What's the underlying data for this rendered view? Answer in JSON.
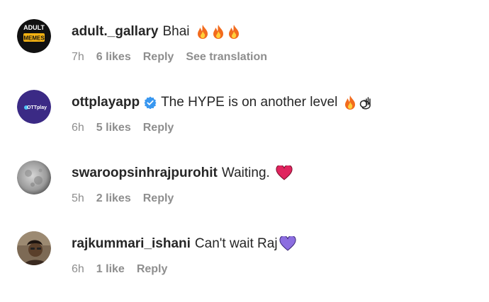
{
  "comments": [
    {
      "avatar": {
        "text_top": "ADULT",
        "text_bottom": "MEMES",
        "colors": {
          "bg": "#111111",
          "accent": "#f5b313"
        }
      },
      "username": "adult._gallary",
      "text": "Bhai",
      "emoji": [
        "fire-emoji",
        "fire-emoji",
        "fire-emoji"
      ],
      "time": "7h",
      "likes": "6 likes",
      "reply": "Reply",
      "translate": "See translation"
    },
    {
      "avatar": {
        "text": "OTTplay",
        "colors": {
          "bg": "#3b2a85"
        }
      },
      "username": "ottplayapp",
      "verified": true,
      "text": "The HYPE is on another level",
      "emoji": [
        "fire-emoji",
        "ok-hand-emoji"
      ],
      "time": "6h",
      "likes": "5 likes",
      "reply": "Reply"
    },
    {
      "avatar": {
        "kind": "moon-photo"
      },
      "username": "swaroopsinhrajpurohit",
      "text": "Waiting.",
      "emoji": [
        "red-heart-emoji"
      ],
      "time": "5h",
      "likes": "2 likes",
      "reply": "Reply"
    },
    {
      "avatar": {
        "kind": "person-photo"
      },
      "username": "rajkummari_ishani",
      "text": "Can't wait Raj",
      "emoji": [
        "purple-heart-emoji"
      ],
      "time": "6h",
      "likes": "1 like",
      "reply": "Reply"
    }
  ],
  "colors": {
    "text": "#262626",
    "muted": "#8e8e8e",
    "verified": "#3897f0",
    "fire": "#f26b1d",
    "heart_red": "#e0245e",
    "heart_purple": "#8c6ee0"
  }
}
